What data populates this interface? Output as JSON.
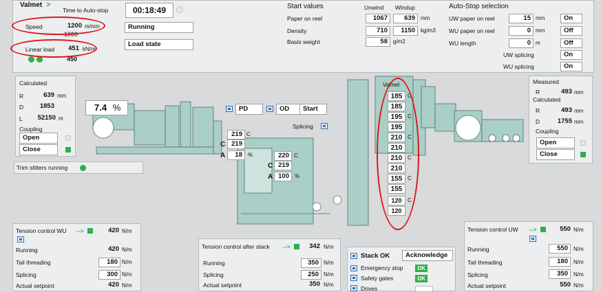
{
  "header": {
    "brand": "Valmet",
    "chevron": ">",
    "time_to_autostop_label": "Time to Auto-stop",
    "time_to_autostop": "00:18:49",
    "speed_label": "Speed",
    "speed_value": "1200",
    "speed_unit": "m/min",
    "speed_sub": "1000",
    "status_running": "Running",
    "linear_load_label": "Linear load",
    "linear_load_value": "451",
    "linear_load_unit": "kN/m",
    "linear_load_sub": "450",
    "load_state": "Load state"
  },
  "start_values": {
    "title": "Start values",
    "col_unwind": "Unwind",
    "col_windup": "Windup",
    "rows": [
      {
        "label": "Paper on reel",
        "unwind": "1067",
        "windup": "639",
        "unit": "mm"
      },
      {
        "label": "Density",
        "unwind": "710",
        "windup": "1150",
        "unit": "kg/m3"
      },
      {
        "label": "Basis weight",
        "unwind": "58",
        "windup": "",
        "unit": "g/m2"
      }
    ]
  },
  "autostop": {
    "title": "Auto-Stop selection",
    "rows": [
      {
        "label": "UW paper on reel",
        "value": "15",
        "unit": "mm",
        "state": "On"
      },
      {
        "label": "WU paper on reel",
        "value": "0",
        "unit": "mm",
        "state": "Off"
      },
      {
        "label": "WU length",
        "value": "0",
        "unit": "m",
        "state": "Off"
      },
      {
        "label": "UW splicing",
        "value": "",
        "unit": "",
        "state": "On"
      },
      {
        "label": "WU splicing",
        "value": "",
        "unit": "",
        "state": "On"
      }
    ]
  },
  "calculated_left": {
    "title": "Calculated",
    "r_label": "R",
    "r_value": "639",
    "r_unit": "mm",
    "d_label": "D",
    "d_value": "1853",
    "l_label": "L",
    "l_value": "52150",
    "l_unit": "m",
    "coupling_label": "Coupling",
    "open_label": "Open",
    "close_label": "Close"
  },
  "percent": {
    "value": "7.4",
    "unit": "%"
  },
  "trim_slitters": "Trim slitters running",
  "controls": {
    "pd": "PD",
    "od": "OD",
    "start": "Start",
    "splicing": "Splicing"
  },
  "carriage1": {
    "top": "219",
    "top_c": "C",
    "c_label": "C",
    "c_value": "219",
    "a_label": "A",
    "a_value": "18",
    "a_unit": "%"
  },
  "carriage2": {
    "top": "220",
    "top_c": "C",
    "c_label": "C",
    "c_value": "219",
    "a_label": "A",
    "a_value": "100",
    "a_unit": "%"
  },
  "valmet_stack": {
    "label": "Valmet",
    "values": [
      "185",
      "185",
      "195",
      "195",
      "210",
      "210",
      "210",
      "210",
      "155",
      "155",
      "120",
      "120"
    ],
    "c_marks": [
      "C",
      "",
      "C",
      "",
      "C",
      "",
      "C",
      "",
      "C",
      "",
      "C",
      ""
    ]
  },
  "measured_right": {
    "title": "Measured",
    "r_label": "R",
    "r_value": "493",
    "r_unit": "mm",
    "calc_title": "Calculated",
    "r2_label": "R",
    "r2_value": "493",
    "r2_unit": "mm",
    "d_label": "D",
    "d_value": "1755",
    "d_unit": "mm",
    "coupling_label": "Coupling",
    "open_label": "Open",
    "close_label": "Close"
  },
  "tension_wu": {
    "title": "Tension control WU",
    "arrow": "-->",
    "title_value": "420",
    "unit": "N/m",
    "rows": [
      {
        "label": "Running",
        "value": "420"
      },
      {
        "label": "Tail threading",
        "value": "180"
      },
      {
        "label": "Splicing",
        "value": "300"
      },
      {
        "label": "Actual setpoint",
        "value": "420"
      }
    ]
  },
  "tension_stack": {
    "title": "Tension control after stack",
    "arrow": "-->",
    "title_value": "342",
    "unit": "N/m",
    "rows": [
      {
        "label": "Running",
        "value": "350"
      },
      {
        "label": "Splicing",
        "value": "250"
      },
      {
        "label": "Actual setpoint",
        "value": "350"
      }
    ]
  },
  "stack_ok": {
    "title": "Stack OK",
    "acknowledge": "Acknowledge",
    "rows": [
      {
        "label": "Emergency stop",
        "status": "OK"
      },
      {
        "label": "Safety gates",
        "status": "OK"
      },
      {
        "label": "Drives",
        "status": ""
      }
    ]
  },
  "tension_uw": {
    "title": "Tension control UW",
    "arrow": "-->",
    "title_value": "550",
    "unit": "N/m",
    "rows": [
      {
        "label": "Running",
        "value": "550"
      },
      {
        "label": "Tail threading",
        "value": "180"
      },
      {
        "label": "Splicing",
        "value": "350"
      },
      {
        "label": "Actual setpoint",
        "value": "550"
      }
    ]
  },
  "colors": {
    "accent_green": "#2fb04a",
    "highlight_red": "#e0151b",
    "machine": "#a9cfc6"
  }
}
